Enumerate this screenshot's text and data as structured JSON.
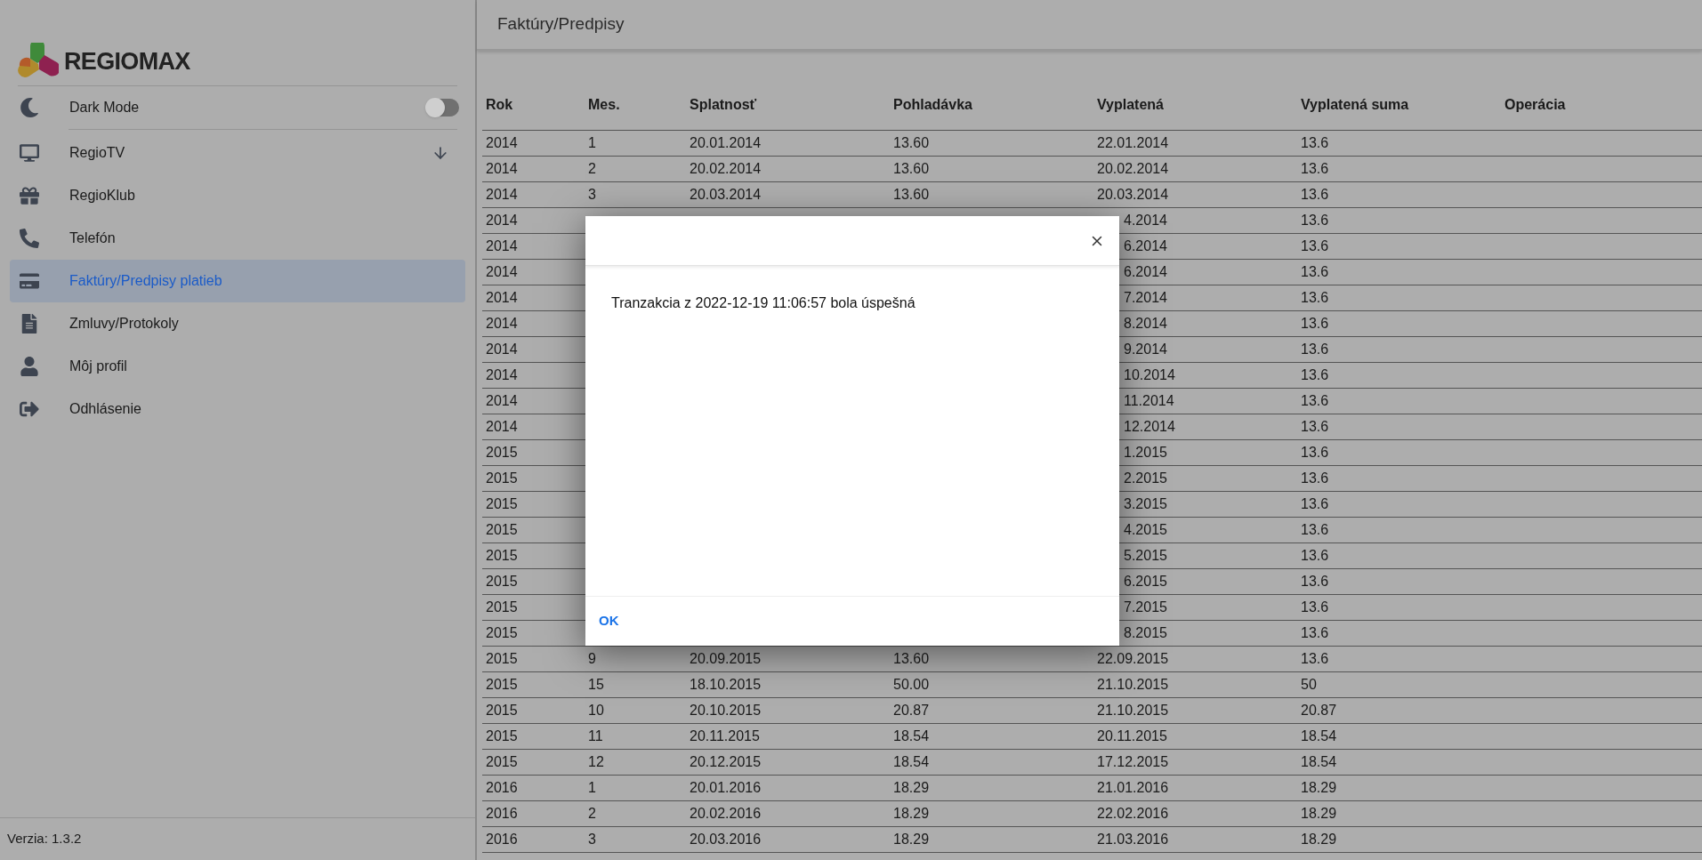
{
  "sidebar": {
    "brand": "REGIOMAX",
    "dark_mode": {
      "label": "Dark Mode",
      "on": false
    },
    "items": [
      {
        "label": "RegioTV",
        "selected": false,
        "expandable": true
      },
      {
        "label": "RegioKlub",
        "selected": false,
        "expandable": false
      },
      {
        "label": "Telefón",
        "selected": false,
        "expandable": false
      },
      {
        "label": "Faktúry/Predpisy platieb",
        "selected": true,
        "expandable": false
      },
      {
        "label": "Zmluvy/Protokoly",
        "selected": false,
        "expandable": false
      },
      {
        "label": "Môj profil",
        "selected": false,
        "expandable": false
      },
      {
        "label": "Odhlásenie",
        "selected": false,
        "expandable": false
      }
    ],
    "version": "Verzia: 1.3.2"
  },
  "page_title": "Faktúry/Predpisy",
  "table": {
    "columns": [
      "Rok",
      "Mes.",
      "Splatnosť",
      "Pohladávka",
      "Vyplatená",
      "Vyplatená suma",
      "Operácia"
    ],
    "rows": [
      {
        "kind": "full",
        "cells": [
          "2014",
          "1",
          "20.01.2014",
          "13.60",
          "22.01.2014",
          "13.6"
        ]
      },
      {
        "kind": "full",
        "cells": [
          "2014",
          "2",
          "20.02.2014",
          "13.60",
          "20.02.2014",
          "13.6"
        ]
      },
      {
        "kind": "full",
        "cells": [
          "2014",
          "3",
          "20.03.2014",
          "13.60",
          "20.03.2014",
          "13.6"
        ]
      },
      {
        "kind": "covered",
        "cells": [
          "2014",
          "4.2014",
          "13.6"
        ]
      },
      {
        "kind": "covered",
        "cells": [
          "2014",
          "6.2014",
          "13.6"
        ]
      },
      {
        "kind": "covered",
        "cells": [
          "2014",
          "6.2014",
          "13.6"
        ]
      },
      {
        "kind": "covered",
        "cells": [
          "2014",
          "7.2014",
          "13.6"
        ]
      },
      {
        "kind": "covered",
        "cells": [
          "2014",
          "8.2014",
          "13.6"
        ]
      },
      {
        "kind": "covered",
        "cells": [
          "2014",
          "9.2014",
          "13.6"
        ]
      },
      {
        "kind": "covered",
        "cells": [
          "2014",
          "10.2014",
          "13.6"
        ]
      },
      {
        "kind": "covered",
        "cells": [
          "2014",
          "11.2014",
          "13.6"
        ]
      },
      {
        "kind": "covered",
        "cells": [
          "2014",
          "12.2014",
          "13.6"
        ]
      },
      {
        "kind": "covered",
        "cells": [
          "2015",
          "1.2015",
          "13.6"
        ]
      },
      {
        "kind": "covered",
        "cells": [
          "2015",
          "2.2015",
          "13.6"
        ]
      },
      {
        "kind": "covered",
        "cells": [
          "2015",
          "3.2015",
          "13.6"
        ]
      },
      {
        "kind": "covered",
        "cells": [
          "2015",
          "4.2015",
          "13.6"
        ]
      },
      {
        "kind": "covered",
        "cells": [
          "2015",
          "5.2015",
          "13.6"
        ]
      },
      {
        "kind": "covered",
        "cells": [
          "2015",
          "6.2015",
          "13.6"
        ]
      },
      {
        "kind": "covered",
        "cells": [
          "2015",
          "7.2015",
          "13.6"
        ]
      },
      {
        "kind": "covered",
        "cells": [
          "2015",
          "8.2015",
          "13.6"
        ]
      },
      {
        "kind": "full",
        "cells": [
          "2015",
          "9",
          "20.09.2015",
          "13.60",
          "22.09.2015",
          "13.6"
        ]
      },
      {
        "kind": "full",
        "cells": [
          "2015",
          "15",
          "18.10.2015",
          "50.00",
          "21.10.2015",
          "50"
        ]
      },
      {
        "kind": "full",
        "cells": [
          "2015",
          "10",
          "20.10.2015",
          "20.87",
          "21.10.2015",
          "20.87"
        ]
      },
      {
        "kind": "full",
        "cells": [
          "2015",
          "11",
          "20.11.2015",
          "18.54",
          "20.11.2015",
          "18.54"
        ]
      },
      {
        "kind": "full",
        "cells": [
          "2015",
          "12",
          "20.12.2015",
          "18.54",
          "17.12.2015",
          "18.54"
        ]
      },
      {
        "kind": "full",
        "cells": [
          "2016",
          "1",
          "20.01.2016",
          "18.29",
          "21.01.2016",
          "18.29"
        ]
      },
      {
        "kind": "full",
        "cells": [
          "2016",
          "2",
          "20.02.2016",
          "18.29",
          "22.02.2016",
          "18.29"
        ]
      },
      {
        "kind": "full",
        "cells": [
          "2016",
          "3",
          "20.03.2016",
          "18.29",
          "21.03.2016",
          "18.29"
        ]
      }
    ]
  },
  "dialog": {
    "message": "Tranzakcia z 2022-12-19 11:06:57 bola úspešná",
    "ok": "OK"
  }
}
